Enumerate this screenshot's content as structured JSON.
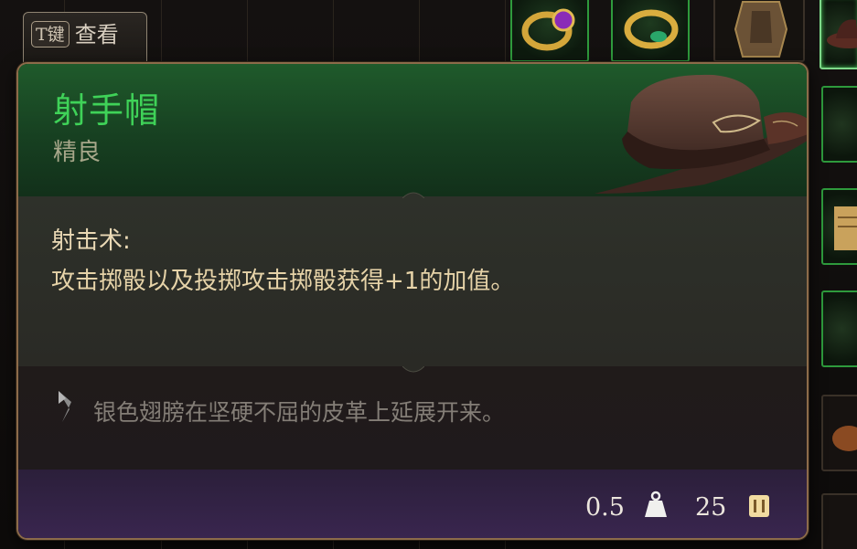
{
  "hint": {
    "key": "T键",
    "action": "查看"
  },
  "item": {
    "name": "射手帽",
    "rarity": "精良",
    "image_icon": "ranger-hat-icon"
  },
  "ability": {
    "title": "射击术:",
    "body": "攻击掷骰以及投掷攻击掷骰获得+1的加值。"
  },
  "flavor": {
    "icon": "quill-icon",
    "text": "银色翅膀在坚硬不屈的皮革上延展开来。"
  },
  "stats": {
    "weight": "0.5",
    "weight_icon": "weight-icon",
    "price": "25",
    "price_icon": "gold-coin-icon"
  },
  "colors": {
    "rarity_accent": "#3fd258",
    "border": "#8c6b4a"
  }
}
